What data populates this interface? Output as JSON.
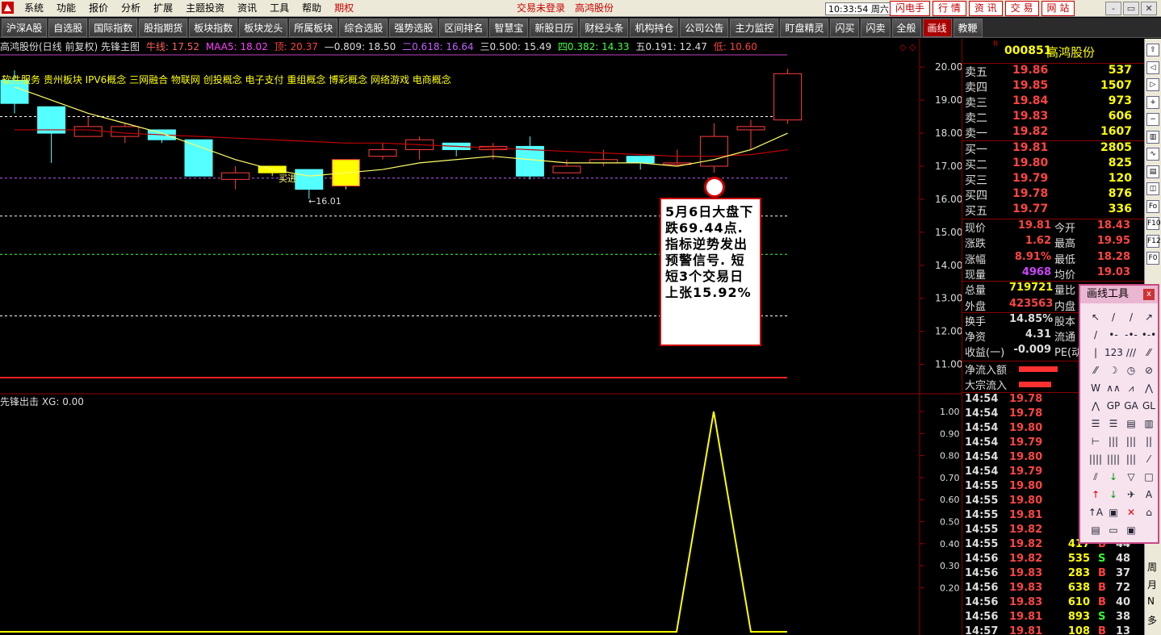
{
  "menubar": {
    "items": [
      "系统",
      "功能",
      "报价",
      "分析",
      "扩展",
      "主题投资",
      "资讯",
      "工具",
      "帮助",
      "期权"
    ],
    "title": "交易未登录　高鸿股份",
    "clock": "10:33:54 周六",
    "links": [
      "闪电手",
      "行 情",
      "资 讯",
      "交 易",
      "网 站"
    ],
    "window_buttons": [
      "-",
      "▭",
      "✕"
    ]
  },
  "tabs": {
    "items": [
      "沪深A股",
      "自选股",
      "国际指数",
      "股指期货",
      "板块指数",
      "板块龙头",
      "所属板块",
      "综合选股",
      "强势选股",
      "区间排名",
      "智慧宝",
      "新股日历",
      "财经头条",
      "机构持仓",
      "公司公告",
      "主力监控",
      "盯盘精灵",
      "闪买",
      "闪卖",
      "全般",
      "画线",
      "教鞭"
    ],
    "active_index": 20
  },
  "chart": {
    "title": "高鸿股份(日线 前复权) 先锋主图",
    "niuxian": "牛线: 17.52",
    "maa5": "MAA5: 18.02",
    "top": "顶: 20.37",
    "l0809": "—0.809: 18.50",
    "l0618": "二0.618: 16.64",
    "l0500": "三0.500: 15.49",
    "l0382": "四0.382: 14.33",
    "l0191": "五0.191: 12.47",
    "bottom": "低: 10.60",
    "concepts": "软件服务 贵州板块 IPV6概念 三网融合 物联网 创投概念 电子支付 重组概念 博彩概念 网络游戏 电商概念",
    "buy_label": "买进",
    "low_mark": "←16.01",
    "lower_title": "先锋出击  XG: 0.00",
    "colors": {
      "up": "#ff3c3c",
      "down": "#54ffff",
      "yellow": "#ffff00",
      "ma_red": "#c00000",
      "ma_yellow": "#ffff66"
    }
  },
  "chart_data": [
    {
      "type": "candlestick",
      "title": "高鸿股份(日线 前复权) 先锋主图",
      "ylim": [
        10.6,
        20.37
      ],
      "yticks": [
        "20.00",
        "19.00",
        "18.00",
        "17.00",
        "16.00",
        "15.00",
        "14.00",
        "13.00",
        "12.00",
        "11.00"
      ],
      "candles": [
        {
          "o": 19.6,
          "c": 18.9,
          "h": 19.9,
          "l": 18.6,
          "kind": "down"
        },
        {
          "o": 18.8,
          "c": 18.0,
          "h": 18.8,
          "l": 17.1,
          "kind": "down"
        },
        {
          "o": 17.9,
          "c": 18.2,
          "h": 18.5,
          "l": 17.9,
          "kind": "up"
        },
        {
          "o": 18.2,
          "c": 17.9,
          "h": 18.3,
          "l": 17.7,
          "kind": "up"
        },
        {
          "o": 18.1,
          "c": 17.8,
          "h": 18.1,
          "l": 17.7,
          "kind": "down"
        },
        {
          "o": 17.8,
          "c": 16.7,
          "h": 17.8,
          "l": 16.7,
          "kind": "down"
        },
        {
          "o": 16.6,
          "c": 16.8,
          "h": 17.0,
          "l": 16.3,
          "kind": "up"
        },
        {
          "o": 16.8,
          "c": 17.0,
          "h": 17.0,
          "l": 16.7,
          "kind": "yellow"
        },
        {
          "o": 16.9,
          "c": 16.3,
          "h": 16.9,
          "l": 16.01,
          "kind": "down"
        },
        {
          "o": 16.4,
          "c": 17.2,
          "h": 17.2,
          "l": 16.3,
          "kind": "yellow"
        },
        {
          "o": 17.3,
          "c": 17.5,
          "h": 17.7,
          "l": 17.2,
          "kind": "up"
        },
        {
          "o": 17.5,
          "c": 17.8,
          "h": 17.9,
          "l": 17.2,
          "kind": "up"
        },
        {
          "o": 17.7,
          "c": 17.5,
          "h": 17.7,
          "l": 17.3,
          "kind": "down"
        },
        {
          "o": 17.5,
          "c": 17.6,
          "h": 17.7,
          "l": 17.2,
          "kind": "up"
        },
        {
          "o": 17.6,
          "c": 16.7,
          "h": 17.9,
          "l": 16.6,
          "kind": "down"
        },
        {
          "o": 16.8,
          "c": 17.0,
          "h": 17.2,
          "l": 16.8,
          "kind": "up"
        },
        {
          "o": 17.1,
          "c": 17.2,
          "h": 17.5,
          "l": 17.0,
          "kind": "up"
        },
        {
          "o": 17.3,
          "c": 17.1,
          "h": 17.3,
          "l": 16.9,
          "kind": "down"
        },
        {
          "o": 17.1,
          "c": 17.1,
          "h": 17.5,
          "l": 17.0,
          "kind": "up"
        },
        {
          "o": 17.0,
          "c": 17.9,
          "h": 18.3,
          "l": 16.8,
          "kind": "up"
        },
        {
          "o": 18.1,
          "c": 18.2,
          "h": 18.4,
          "l": 17.5,
          "kind": "up"
        },
        {
          "o": 18.4,
          "c": 19.8,
          "h": 19.95,
          "l": 18.28,
          "kind": "up"
        }
      ],
      "ma_yellow": [
        19.4,
        19.0,
        18.6,
        18.3,
        18.0,
        17.6,
        17.2,
        16.9,
        16.7,
        16.8,
        16.9,
        17.1,
        17.2,
        17.3,
        17.2,
        17.1,
        17.1,
        17.1,
        17.0,
        17.2,
        17.5,
        18.0
      ],
      "ma_red": [
        18.1,
        18.1,
        18.1,
        18.0,
        17.95,
        17.9,
        17.85,
        17.8,
        17.75,
        17.7,
        17.7,
        17.65,
        17.6,
        17.55,
        17.5,
        17.45,
        17.4,
        17.35,
        17.3,
        17.3,
        17.35,
        17.5
      ],
      "levels": [
        {
          "value": 18.5,
          "color": "#ffffff"
        },
        {
          "value": 16.64,
          "color": "#c060ff"
        },
        {
          "value": 15.49,
          "color": "#ffffff"
        },
        {
          "value": 14.33,
          "color": "#40ff40"
        },
        {
          "value": 12.47,
          "color": "#ffffff"
        },
        {
          "value": 10.6,
          "color": "#ff2020"
        }
      ]
    },
    {
      "type": "line",
      "title": "先锋出击  XG: 0.00",
      "ylim": [
        0,
        1.0
      ],
      "yticks": [
        "1.00",
        "0.90",
        "0.80",
        "0.70",
        "0.60",
        "0.50",
        "0.40",
        "0.30",
        "0.20"
      ],
      "values": [
        0,
        0,
        0,
        0,
        0,
        0,
        0,
        0,
        0,
        0,
        0,
        0,
        0,
        0,
        0,
        0,
        0,
        0,
        0,
        0,
        1,
        0,
        0
      ]
    }
  ],
  "annotation": {
    "text": "5月6日大盘下跌69.44点. 指标逆势发出预警信号. 短短3个交易日上张15.92%"
  },
  "quote": {
    "badge": "R",
    "code": "000851",
    "name": "高鸿股份",
    "asks": [
      {
        "label": "卖五",
        "price": "19.86",
        "vol": "537"
      },
      {
        "label": "卖四",
        "price": "19.85",
        "vol": "1507"
      },
      {
        "label": "卖三",
        "price": "19.84",
        "vol": "973"
      },
      {
        "label": "卖二",
        "price": "19.83",
        "vol": "606"
      },
      {
        "label": "卖一",
        "price": "19.82",
        "vol": "1607"
      }
    ],
    "bids": [
      {
        "label": "买一",
        "price": "19.81",
        "vol": "2805"
      },
      {
        "label": "买二",
        "price": "19.80",
        "vol": "825"
      },
      {
        "label": "买三",
        "price": "19.79",
        "vol": "120"
      },
      {
        "label": "买四",
        "price": "19.78",
        "vol": "876"
      },
      {
        "label": "买五",
        "price": "19.77",
        "vol": "336"
      }
    ],
    "stats": [
      {
        "l": "现价",
        "a": "19.81",
        "ac": "#ff4444",
        "l2": "今开",
        "b": "18.43"
      },
      {
        "l": "涨跌",
        "a": "1.62",
        "ac": "#ff4444",
        "l2": "最高",
        "b": "19.95"
      },
      {
        "l": "涨幅",
        "a": "8.91%",
        "ac": "#ff4444",
        "l2": "最低",
        "b": "18.28"
      },
      {
        "l": "现量",
        "a": "4968",
        "ac": "#cc44ff",
        "l2": "均价",
        "b": "19.03"
      },
      {
        "l": "总量",
        "a": "719721",
        "ac": "#ffff00",
        "l2": "量比",
        "b": ""
      },
      {
        "l": "外盘",
        "a": "423563",
        "ac": "#ff4444",
        "l2": "内盘",
        "b": ""
      },
      {
        "l": "换手",
        "a": "14.85%",
        "ac": "#dddddd",
        "l2": "股本",
        "b": ""
      },
      {
        "l": "净资",
        "a": "4.31",
        "ac": "#dddddd",
        "l2": "流通",
        "b": ""
      },
      {
        "l": "收益(一)",
        "a": "-0.009",
        "ac": "#dddddd",
        "l2": "PE(动",
        "b": ""
      }
    ],
    "flows": [
      {
        "l": "净流入额"
      },
      {
        "l": "大宗流入"
      }
    ],
    "ticks": [
      {
        "t": "14:54",
        "p": "19.78",
        "v": "",
        "s": "",
        "n": ""
      },
      {
        "t": "14:54",
        "p": "19.78",
        "v": "",
        "s": "",
        "n": ""
      },
      {
        "t": "14:54",
        "p": "19.80",
        "v": "",
        "s": "",
        "n": ""
      },
      {
        "t": "14:54",
        "p": "19.79",
        "v": "",
        "s": "",
        "n": ""
      },
      {
        "t": "14:54",
        "p": "19.80",
        "v": "",
        "s": "",
        "n": ""
      },
      {
        "t": "14:54",
        "p": "19.79",
        "v": "",
        "s": "",
        "n": ""
      },
      {
        "t": "14:55",
        "p": "19.80",
        "v": "",
        "s": "",
        "n": ""
      },
      {
        "t": "14:55",
        "p": "19.80",
        "v": "",
        "s": "",
        "n": ""
      },
      {
        "t": "14:55",
        "p": "19.81",
        "v": "",
        "s": "",
        "n": ""
      },
      {
        "t": "14:55",
        "p": "19.82",
        "v": "",
        "s": "",
        "n": ""
      },
      {
        "t": "14:55",
        "p": "19.82",
        "v": "417",
        "s": "B",
        "n": "44"
      },
      {
        "t": "14:56",
        "p": "19.82",
        "v": "535",
        "s": "S",
        "n": "48"
      },
      {
        "t": "14:56",
        "p": "19.83",
        "v": "283",
        "s": "B",
        "n": "37"
      },
      {
        "t": "14:56",
        "p": "19.83",
        "v": "638",
        "s": "B",
        "n": "72"
      },
      {
        "t": "14:56",
        "p": "19.83",
        "v": "610",
        "s": "B",
        "n": "40"
      },
      {
        "t": "14:56",
        "p": "19.81",
        "v": "893",
        "s": "S",
        "n": "38"
      },
      {
        "t": "14:57",
        "p": "19.81",
        "v": "108",
        "s": "B",
        "n": "13"
      }
    ]
  },
  "side_toolbar": {
    "chars": [
      "周",
      "月",
      "N",
      "多"
    ]
  },
  "draw_tool": {
    "title": "画线工具",
    "close": "x",
    "tools": [
      "↖",
      "/",
      "/",
      "↗",
      "/",
      "•-",
      "-•-",
      "•-•",
      "|",
      "123",
      "///",
      "⁄⁄",
      "⁄⁄",
      "☽",
      "◷",
      "⊘",
      "W",
      "∧∧",
      "⩘",
      "⋀",
      "⋀",
      "GP",
      "GA",
      "GL",
      "☰",
      "☰",
      "▤",
      "▥",
      "⊢",
      "|||",
      "|||",
      "||",
      "||||",
      "||||",
      "|||",
      "⁄",
      "⫽",
      "↓",
      "▽",
      "□",
      "↑",
      "↓",
      "✈",
      "A",
      "↑A",
      "▣",
      "✕",
      "⌂",
      "▤",
      "▭",
      "▣",
      ""
    ]
  }
}
